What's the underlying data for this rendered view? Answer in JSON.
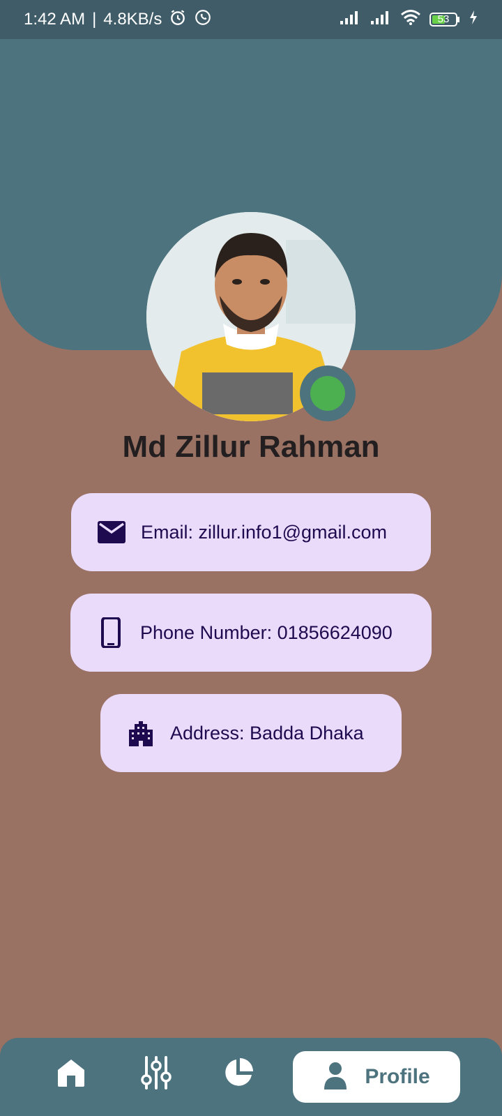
{
  "status_bar": {
    "time": "1:42 AM",
    "separator": "|",
    "speed": "4.8KB/s",
    "icons": [
      "alarm-icon",
      "whatsapp-icon",
      "signal-icon",
      "signal-icon",
      "wifi-icon",
      "battery-icon",
      "charging-icon"
    ],
    "battery_level": "53"
  },
  "profile": {
    "name": "Md Zillur Rahman",
    "online": true
  },
  "cards": {
    "email": {
      "icon": "mail-icon",
      "label": "Email: zillur.info1@gmail.com"
    },
    "phone": {
      "icon": "smartphone-icon",
      "label": "Phone Number: 01856624090"
    },
    "address": {
      "icon": "building-icon",
      "label": "Address: Badda Dhaka"
    }
  },
  "bottom_nav": {
    "items": [
      {
        "icon": "home-icon"
      },
      {
        "icon": "sliders-icon"
      },
      {
        "icon": "pie-chart-icon"
      },
      {
        "icon": "person-icon",
        "label": "Profile",
        "active": true
      }
    ]
  },
  "colors": {
    "header": "#4d737e",
    "background": "#9a7264",
    "card": "#eadbfb",
    "card_text": "#1e0a4e",
    "online": "#4caf50"
  }
}
